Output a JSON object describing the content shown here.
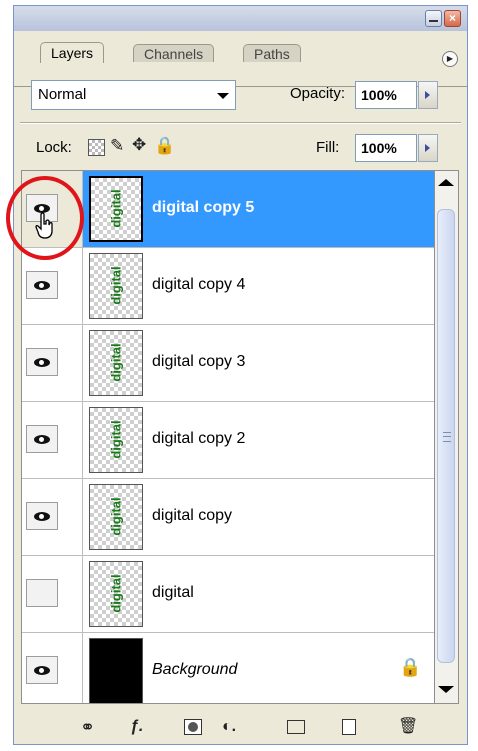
{
  "panel": {
    "tabs": [
      {
        "label": "Layers",
        "active": true
      },
      {
        "label": "Channels",
        "active": false
      },
      {
        "label": "Paths",
        "active": false
      }
    ],
    "blend_mode": "Normal",
    "opacity_label": "Opacity:",
    "opacity_value": "100%",
    "lock_label": "Lock:",
    "fill_label": "Fill:",
    "fill_value": "100%"
  },
  "layers": [
    {
      "name": "digital copy 5",
      "visible": true,
      "selected": true
    },
    {
      "name": "digital copy 4",
      "visible": true,
      "selected": false
    },
    {
      "name": "digital copy 3",
      "visible": true,
      "selected": false
    },
    {
      "name": "digital copy 2",
      "visible": true,
      "selected": false
    },
    {
      "name": "digital copy",
      "visible": true,
      "selected": false
    },
    {
      "name": "digital",
      "visible": false,
      "selected": false
    },
    {
      "name": "Background",
      "visible": true,
      "selected": false,
      "locked": true
    }
  ],
  "thumbnail_text": "digital",
  "colors": {
    "selection": "#3399ff",
    "highlight_circle": "#e0151a",
    "thumb_text": "#1a7a1a"
  },
  "icons": {
    "close": "close-icon",
    "minimize": "minimize-icon",
    "menu": "panel-menu-icon",
    "lock_transparent": "lock-transparent-icon",
    "lock_paint": "brush-icon",
    "lock_move": "move-icon",
    "lock_all": "lock-icon",
    "eye": "eye-icon",
    "bottom": [
      "link-icon",
      "fx-icon",
      "mask-icon",
      "adjustment-icon",
      "folder-icon",
      "new-layer-icon",
      "trash-icon"
    ]
  }
}
